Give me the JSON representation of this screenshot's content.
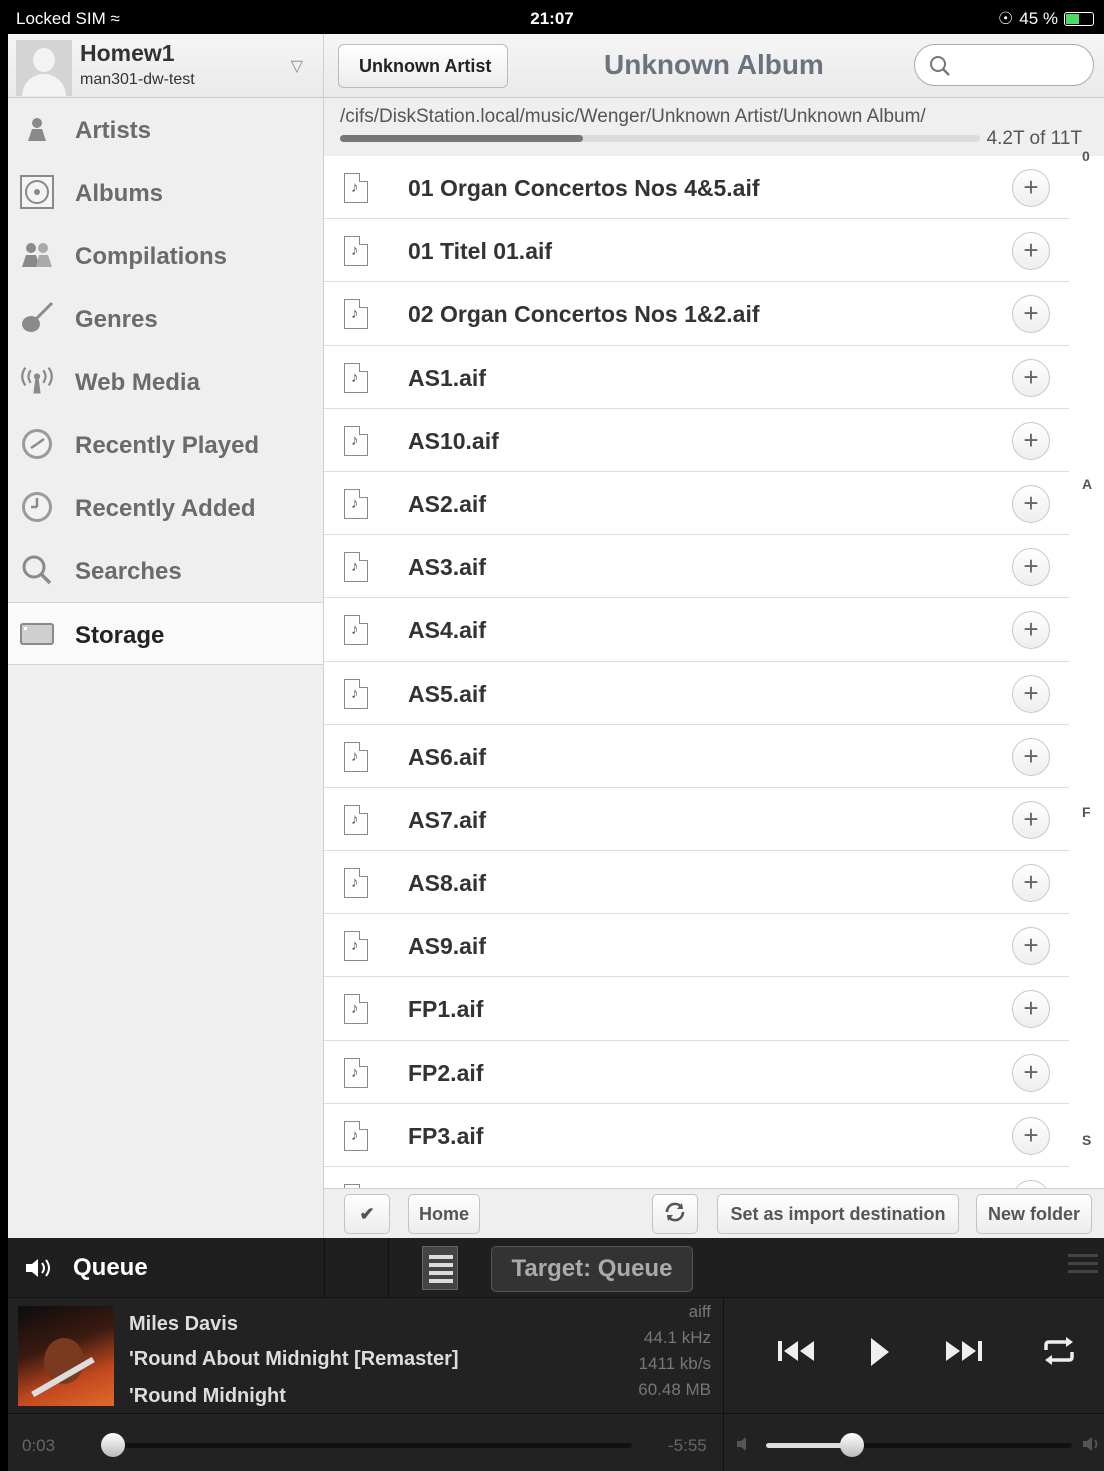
{
  "status_bar": {
    "carrier": "Locked SIM",
    "time": "21:07",
    "battery": "45 %",
    "battery_level": 0.45
  },
  "sidebar": {
    "account": {
      "name": "Homew1",
      "sub": "man301-dw-test"
    },
    "items": [
      {
        "label": "Artists",
        "icon": "person-icon"
      },
      {
        "label": "Albums",
        "icon": "disc-icon"
      },
      {
        "label": "Compilations",
        "icon": "people-icon"
      },
      {
        "label": "Genres",
        "icon": "guitar-icon"
      },
      {
        "label": "Web Media",
        "icon": "antenna-icon"
      },
      {
        "label": "Recently Played",
        "icon": "clock-icon"
      },
      {
        "label": "Recently Added",
        "icon": "clock-icon"
      },
      {
        "label": "Searches",
        "icon": "search-icon"
      },
      {
        "label": "Storage",
        "icon": "drive-icon",
        "active": true
      }
    ]
  },
  "header": {
    "back_label": "Unknown Artist",
    "title": "Unknown Album",
    "search_placeholder": ""
  },
  "path": {
    "text": "/cifs/DiskStation.local/music/Wenger/Unknown Artist/Unknown Album/",
    "storage": "4.2T of 11T",
    "usage_fraction": 0.38
  },
  "files": [
    "01 Organ Concertos Nos 4&5.aif",
    "01 Titel 01.aif",
    "02 Organ Concertos Nos 1&2.aif",
    "AS1.aif",
    "AS10.aif",
    "AS2.aif",
    "AS3.aif",
    "AS4.aif",
    "AS5.aif",
    "AS6.aif",
    "AS7.aif",
    "AS8.aif",
    "AS9.aif",
    "FP1.aif",
    "FP2.aif",
    "FP3.aif"
  ],
  "index_letters": [
    "0",
    "A",
    "F",
    "S"
  ],
  "toolbar": {
    "home": "Home",
    "import": "Set as import destination",
    "new_folder": "New folder"
  },
  "player": {
    "queue_label": "Queue",
    "target": "Target: Queue",
    "artist": "Miles Davis",
    "album": "'Round About Midnight [Remaster]",
    "track": "'Round Midnight",
    "format": "aiff",
    "sample_rate": "44.1 kHz",
    "bitrate": "1411 kb/s",
    "size": "60.48 MB",
    "elapsed": "0:03",
    "remaining": "-5:55",
    "position_fraction": 0.01,
    "volume_fraction": 0.28
  }
}
